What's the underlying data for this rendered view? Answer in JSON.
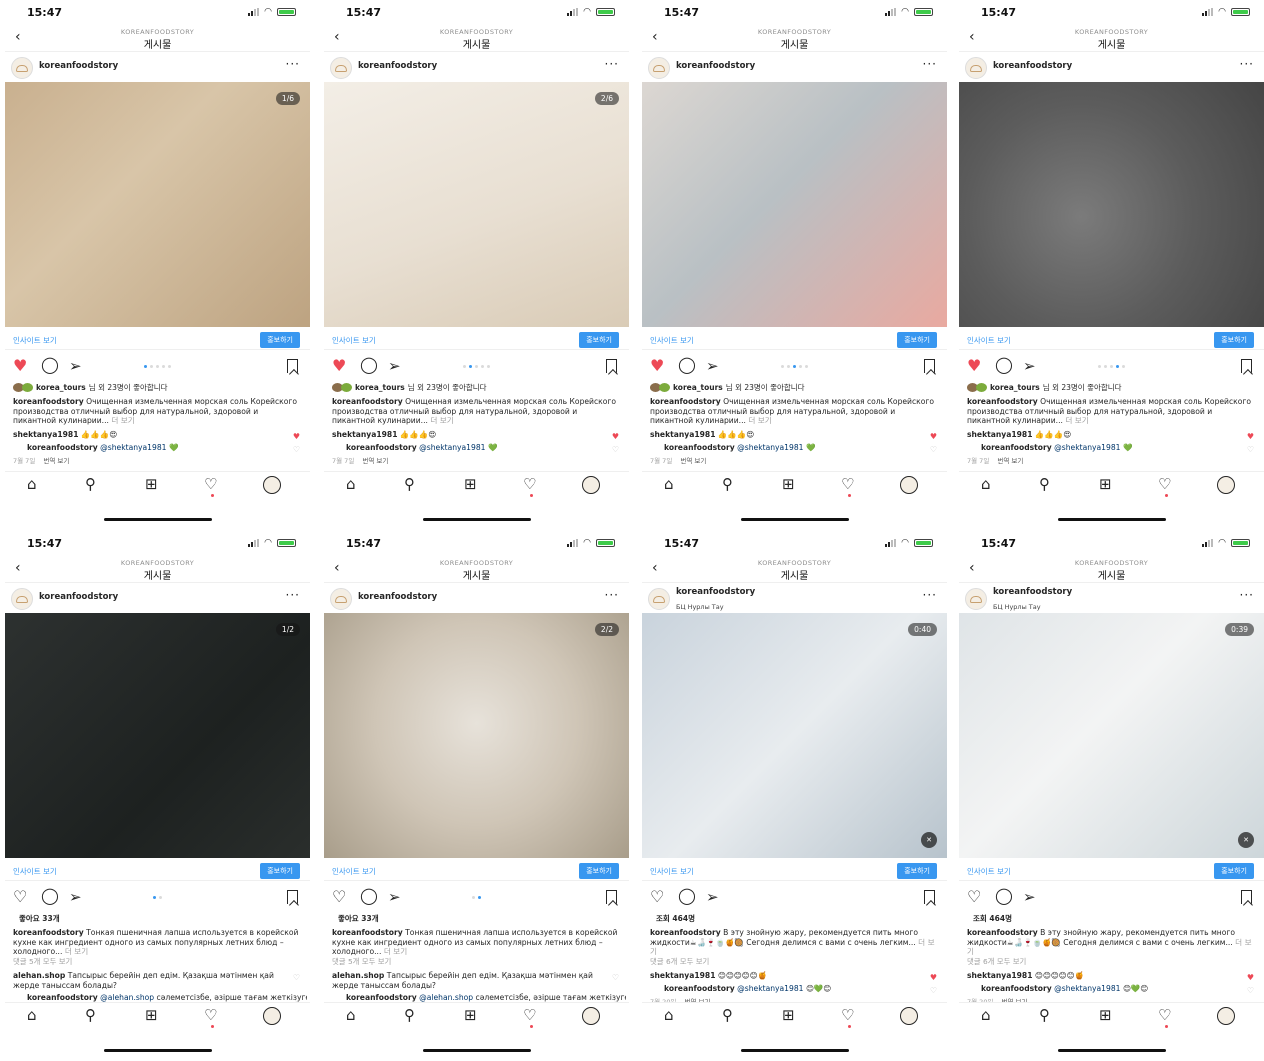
{
  "common": {
    "time": "15:47",
    "nav_account": "KOREANFOODSTORY",
    "nav_title": "게시물",
    "username": "koreanfoodstory",
    "insights": "인사이트 보기",
    "promote": "홍보하기",
    "more_glyph": "···",
    "more_text": "더 보기"
  },
  "screens": [
    {
      "counter": "1/6",
      "location": "",
      "dots_total": 5,
      "dot_active": 1,
      "liked": true,
      "likes_user": "korea_tours",
      "likes_suffix": "님 외 23명이 좋아합니다",
      "likes_plain": "",
      "caption": "Очищенная измельченная морская соль Корейского производства отличный выбор для натуральной, здоровой и пикантной кулинарии...",
      "view_all": "",
      "c1_user": "shektanya1981",
      "c1_text": "👍👍👍😍",
      "c1_heart": "♥",
      "c2_user": "koreanfoodstory",
      "c2_mention": "@shektanya1981",
      "c2_text": "💚",
      "date": "7월 7일",
      "translate": "번역 보기",
      "photo": "linear-gradient(135deg,#c9b08f 0%,#d8c5a8 40%,#bda381 100%)"
    },
    {
      "counter": "2/6",
      "location": "",
      "dots_total": 5,
      "dot_active": 2,
      "liked": true,
      "likes_user": "korea_tours",
      "likes_suffix": "님 외 23명이 좋아합니다",
      "likes_plain": "",
      "caption": "Очищенная измельченная морская соль Корейского производства отличный выбор для натуральной, здоровой и пикантной кулинарии...",
      "view_all": "",
      "c1_user": "shektanya1981",
      "c1_text": "👍👍👍😍",
      "c1_heart": "♥",
      "c2_user": "koreanfoodstory",
      "c2_mention": "@shektanya1981",
      "c2_text": "💚",
      "date": "7월 7일",
      "translate": "번역 보기",
      "photo": "linear-gradient(160deg,#f3eee6 0%,#e8dfd2 55%,#d9cbb6 100%)"
    },
    {
      "counter": "",
      "location": "",
      "dots_total": 5,
      "dot_active": 3,
      "liked": true,
      "likes_user": "korea_tours",
      "likes_suffix": "님 외 23명이 좋아합니다",
      "likes_plain": "",
      "caption": "Очищенная измельченная морская соль Корейского производства отличный выбор для натуральной, здоровой и пикантной кулинарии...",
      "view_all": "",
      "c1_user": "shektanya1981",
      "c1_text": "👍👍👍😍",
      "c1_heart": "♥",
      "c2_user": "koreanfoodstory",
      "c2_mention": "@shektanya1981",
      "c2_text": "💚",
      "date": "7월 7일",
      "translate": "번역 보기",
      "photo": "linear-gradient(135deg,#dcd7d2 0%,#b9c0c4 45%,#e9a9a0 100%)"
    },
    {
      "counter": "",
      "location": "",
      "dots_total": 5,
      "dot_active": 4,
      "liked": true,
      "likes_user": "korea_tours",
      "likes_suffix": "님 외 23명이 좋아합니다",
      "likes_plain": "",
      "caption": "Очищенная измельченная морская соль Корейского производства отличный выбор для натуральной, здоровой и пикантной кулинарии...",
      "view_all": "",
      "c1_user": "shektanya1981",
      "c1_text": "👍👍👍😍",
      "c1_heart": "♥",
      "c2_user": "koreanfoodstory",
      "c2_mention": "@shektanya1981",
      "c2_text": "💚",
      "date": "7월 7일",
      "translate": "번역 보기",
      "photo": "radial-gradient(circle at 40% 55%,#7b7b7b 0%,#5c5c5c 50%,#454545 100%)"
    },
    {
      "counter": "1/2",
      "location": "",
      "dots_total": 2,
      "dot_active": 1,
      "liked": false,
      "likes_user": "",
      "likes_suffix": "",
      "likes_plain": "좋아요 33개",
      "caption": "Тонкая пшеничная лапша используется в корейской кухне как ингредиент одного из самых популярных летних блюд – холодного...",
      "view_all": "댓글 5개 모두 보기",
      "c1_user": "alehan.shop",
      "c1_text": "Тапсырыс берейін деп едім. Қазақша мәтінмен қай жерде таныссам болады?",
      "c1_heart": "♡",
      "c2_user": "koreanfoodstory",
      "c2_mention": "@alehan.shop",
      "c2_text": "сәлеметсізбе, әзірше тағам жеткізуге тапсырыс",
      "date": "",
      "translate": "",
      "photo": "linear-gradient(135deg,#2d3130 0%,#1d2120 60%,#2a2e2c 100%)"
    },
    {
      "counter": "2/2",
      "location": "",
      "dots_total": 2,
      "dot_active": 2,
      "liked": false,
      "likes_user": "",
      "likes_suffix": "",
      "likes_plain": "좋아요 33개",
      "caption": "Тонкая пшеничная лапша используется в корейской кухне как ингредиент одного из самых популярных летних блюд – холодного...",
      "view_all": "댓글 5개 모두 보기",
      "c1_user": "alehan.shop",
      "c1_text": "Тапсырыс берейін деп едім. Қазақша мәтінмен қай жерде таныссам болады?",
      "c1_heart": "♡",
      "c2_user": "koreanfoodstory",
      "c2_mention": "@alehan.shop",
      "c2_text": "сәлеметсізбе, әзірше тағам жеткізуге тапсырыс",
      "date": "",
      "translate": "",
      "photo": "radial-gradient(circle at 50% 45%,#e7e2da 0%,#cfc5b6 50%,#a89d8a 100%)"
    },
    {
      "counter": "0:40",
      "location": "БЦ Нурлы Тау",
      "dots_total": 0,
      "dot_active": 0,
      "liked": false,
      "likes_user": "",
      "likes_suffix": "",
      "likes_plain": "조회 464명",
      "caption": "В эту знойную жару, рекомендуется пить много жидкости☕🍶🍷🍵🍯🥘 Сегодня делимся с вами с очень легким...",
      "view_all": "댓글 6개 모두 보기",
      "c1_user": "shektanya1981",
      "c1_text": "😊😊😊😊😊🍯",
      "c1_heart": "♥",
      "c2_user": "koreanfoodstory",
      "c2_mention": "@shektanya1981",
      "c2_text": "😊💚😊",
      "date": "7월 20일",
      "translate": "번역 보기",
      "photo": "linear-gradient(135deg,#c9d3dc 0%,#e8ecef 50%,#b7c3cc 100%)"
    },
    {
      "counter": "0:39",
      "location": "БЦ Нурлы Тау",
      "dots_total": 0,
      "dot_active": 0,
      "liked": false,
      "likes_user": "",
      "likes_suffix": "",
      "likes_plain": "조회 464명",
      "caption": "В эту знойную жару, рекомендуется пить много жидкости☕🍶🍷🍵🍯🥘 Сегодня делимся с вами с очень легким...",
      "view_all": "댓글 6개 모두 보기",
      "c1_user": "shektanya1981",
      "c1_text": "😊😊😊😊😊🍯",
      "c1_heart": "♥",
      "c2_user": "koreanfoodstory",
      "c2_mention": "@shektanya1981",
      "c2_text": "😊💚😊",
      "date": "7월 20일",
      "translate": "번역 보기",
      "photo": "linear-gradient(135deg,#dfe4e7 0%,#f3f4f4 45%,#cdd6da 100%)"
    }
  ],
  "colors": {
    "accent": "#3897f0",
    "like": "#ed4956"
  },
  "icons": {
    "status": [
      "signal-icon",
      "wifi-icon",
      "battery-icon"
    ],
    "post": [
      "heart-icon",
      "comment-icon",
      "share-icon",
      "bookmark-icon"
    ],
    "tabs": [
      "home-icon",
      "search-icon",
      "add-icon",
      "activity-heart-icon",
      "profile-icon"
    ]
  }
}
